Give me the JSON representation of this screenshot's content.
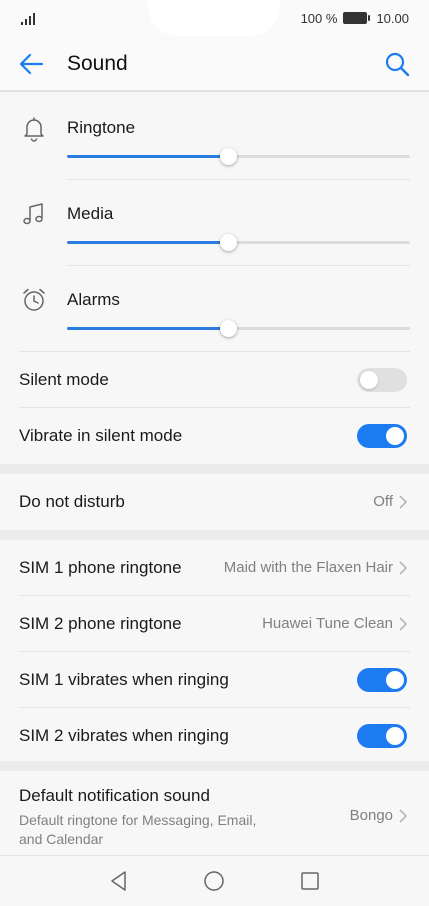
{
  "status_bar": {
    "battery_text": "100 %",
    "time": "10.00",
    "icons": [
      "signal-icon",
      "battery-icon"
    ]
  },
  "app_bar": {
    "title": "Sound",
    "icons": [
      "back-arrow-icon",
      "search-icon"
    ]
  },
  "volume": [
    {
      "label": "Ringtone",
      "icon": "bell-icon",
      "level": 0.47
    },
    {
      "label": "Media",
      "icon": "music-note-icon",
      "level": 0.47
    },
    {
      "label": "Alarms",
      "icon": "alarm-clock-icon",
      "level": 0.47
    }
  ],
  "silent_mode": {
    "label": "Silent mode",
    "on": false
  },
  "vibrate_silent": {
    "label": "Vibrate in silent mode",
    "on": true
  },
  "dnd": {
    "label": "Do not disturb",
    "value": "Off"
  },
  "sim1_ringtone": {
    "label": "SIM 1 phone ringtone",
    "value": "Maid with the Flaxen Hair"
  },
  "sim2_ringtone": {
    "label": "SIM 2 phone ringtone",
    "value": "Huawei Tune Clean"
  },
  "sim1_vibrate": {
    "label": "SIM 1 vibrates when ringing",
    "on": true
  },
  "sim2_vibrate": {
    "label": "SIM 2 vibrates when ringing",
    "on": true
  },
  "notification_sound": {
    "label": "Default notification sound",
    "subtitle": "Default ringtone for Messaging, Email, and Calendar",
    "value": "Bongo"
  },
  "nav_bar": {
    "icons": [
      "back-triangle-icon",
      "home-circle-icon",
      "recents-square-icon"
    ]
  },
  "colors": {
    "accent": "#1c7bf0",
    "slider": "#2a7ce0",
    "switch_off": "#e0e0e0",
    "secondary_text": "#808080"
  }
}
